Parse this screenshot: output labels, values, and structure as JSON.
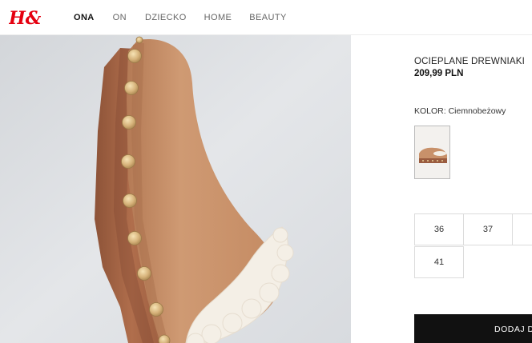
{
  "brand": {
    "logo_text": "H&M",
    "accent": "#e50010"
  },
  "nav": {
    "items": [
      {
        "label": "ONA",
        "active": true
      },
      {
        "label": "ON"
      },
      {
        "label": "DZIECKO"
      },
      {
        "label": "HOME"
      },
      {
        "label": "BEAUTY"
      }
    ]
  },
  "product": {
    "name": "OCIEPLANE DREWNIAKI",
    "price": "209,99 PLN",
    "color_label": "KOLOR: Ciemnobeżowy",
    "sizes": [
      "36",
      "37",
      "41"
    ],
    "add_button": "DODAJ D"
  },
  "colors": {
    "suede": "#c8916a",
    "background": "#dcdfe3",
    "button": "#111111"
  }
}
